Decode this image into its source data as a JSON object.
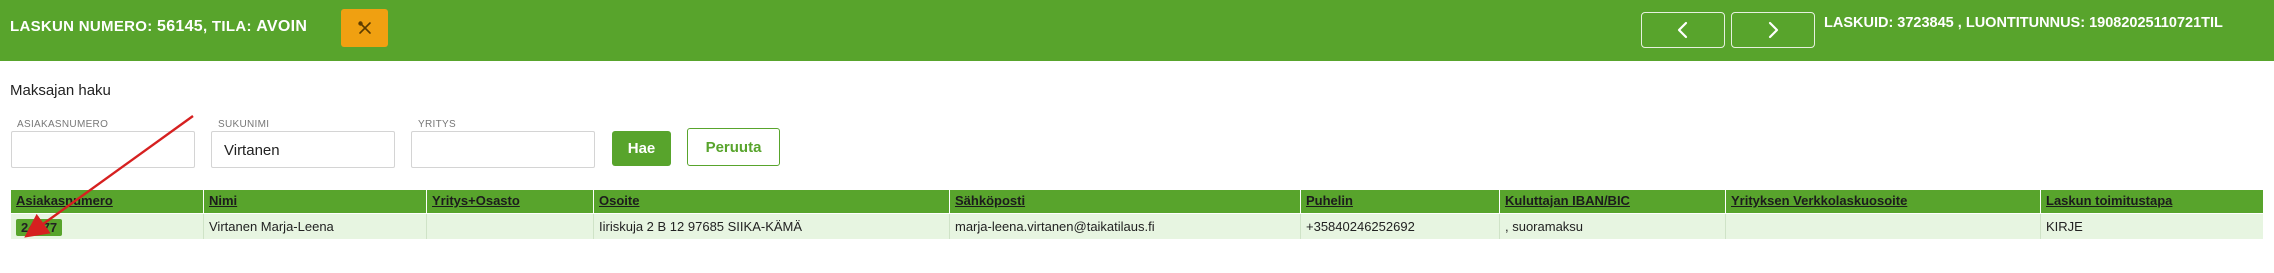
{
  "header": {
    "invoice_label": "LASKUN NUMERO:",
    "invoice_number": "56145",
    "status_label": ", TILA:",
    "status_value": "AVOIN",
    "tools_icon": "wrench-screwdriver-icon",
    "prev_icon": "chevron-left-icon",
    "next_icon": "chevron-right-icon",
    "right_info": "LASKUID: 3723845 , LUONTITUNNUS: 19082025110721TIL"
  },
  "search": {
    "title": "Maksajan haku",
    "customer_number": {
      "label": "ASIAKASNUMERO",
      "value": ""
    },
    "surname": {
      "label": "SUKUNIMI",
      "value": "Virtanen"
    },
    "company": {
      "label": "YRITYS",
      "value": ""
    },
    "search_button": "Hae",
    "cancel_button": "Peruuta"
  },
  "table": {
    "columns": [
      "Asiakasnumero",
      "Nimi",
      "Yritys+Osasto",
      "Osoite",
      "Sähköposti",
      "Puhelin",
      "Kuluttajan IBAN/BIC",
      "Yrityksen Verkkolaskuosoite",
      "Laskun toimitustapa"
    ],
    "rows": [
      [
        "24277",
        "Virtanen Marja-Leena",
        "",
        "Iiriskuja 2 B 12 97685 SIIKA-KÄMÄ",
        "marja-leena.virtanen@taikatilaus.fi",
        "+35840246252692",
        ", suoramaksu",
        "",
        "KIRJE"
      ]
    ]
  },
  "colors": {
    "brand_green": "#58a42c",
    "tools_orange": "#f0a011",
    "row_bg": "#e7f5e1",
    "arrow_red": "#d62020"
  }
}
